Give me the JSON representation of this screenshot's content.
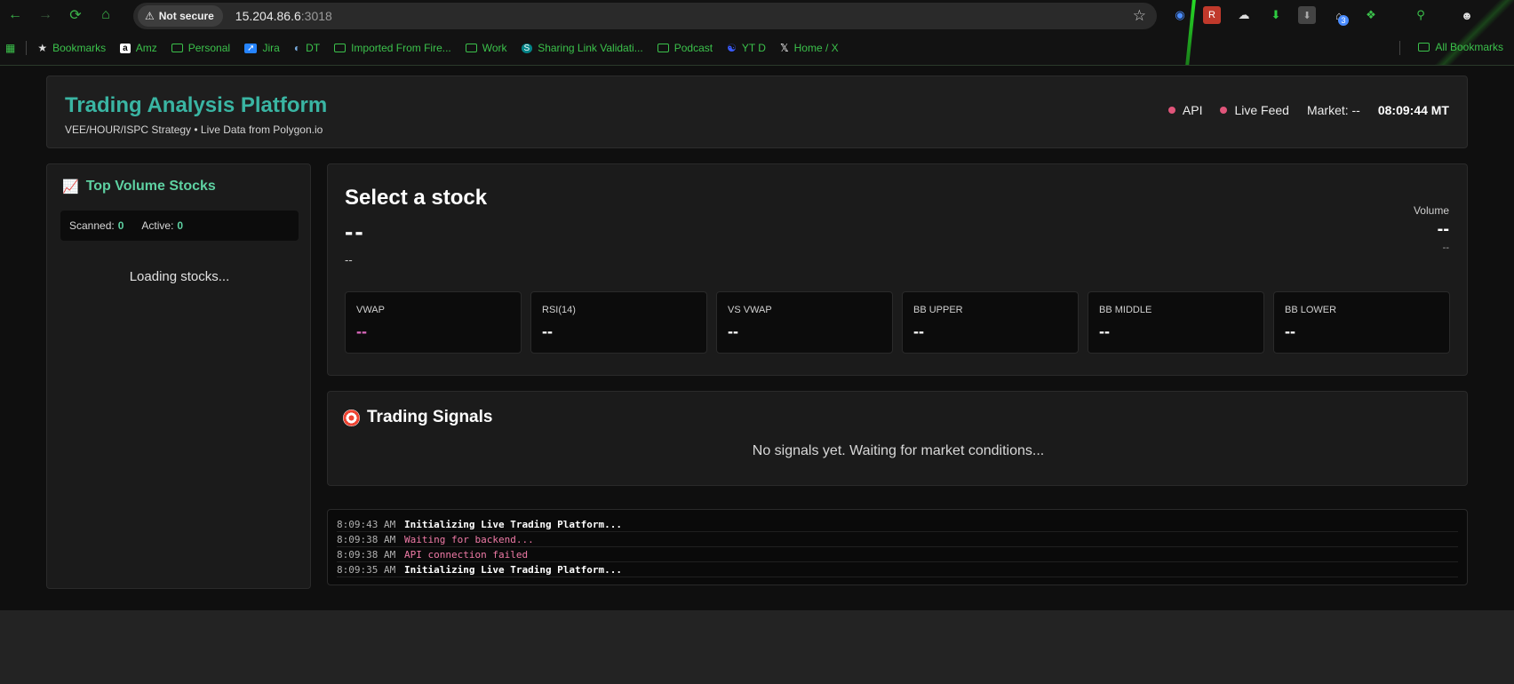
{
  "browser": {
    "security_label": "Not secure",
    "url_host": "15.204.86.6",
    "url_port": ":3018",
    "bookmarks": [
      {
        "label": "Bookmarks",
        "icon": "star-icon"
      },
      {
        "label": "Amz",
        "icon": "amazon-icon"
      },
      {
        "label": "Personal",
        "icon": "folder-icon"
      },
      {
        "label": "Jira",
        "icon": "jira-icon"
      },
      {
        "label": "DT",
        "icon": "dt-icon"
      },
      {
        "label": "Imported From Fire...",
        "icon": "folder-icon"
      },
      {
        "label": "Work",
        "icon": "folder-icon"
      },
      {
        "label": "Sharing Link Validati...",
        "icon": "sharepoint-icon"
      },
      {
        "label": "Podcast",
        "icon": "folder-icon"
      },
      {
        "label": "YT D",
        "icon": "yt-d-icon"
      },
      {
        "label": "Home / X",
        "icon": "x-icon"
      }
    ],
    "all_bookmarks_label": "All Bookmarks",
    "extension_badge": "3"
  },
  "header": {
    "title": "Trading Analysis Platform",
    "subtitle": "VEE/HOUR/ISPC Strategy • Live Data from Polygon.io",
    "api_label": "API",
    "feed_label": "Live Feed",
    "market_label": "Market: --",
    "clock": "08:09:44 MT",
    "status_color": "#e0557a"
  },
  "sidebar": {
    "title": "Top Volume Stocks",
    "scanned_label": "Scanned:",
    "scanned_value": "0",
    "active_label": "Active:",
    "active_value": "0",
    "loading_text": "Loading stocks..."
  },
  "stock": {
    "title": "Select a stock",
    "price": "--",
    "change": "--",
    "volume_label": "Volume",
    "volume_value": "--",
    "volume_sub": "--",
    "indicators": [
      {
        "label": "VWAP",
        "value": "--"
      },
      {
        "label": "RSI(14)",
        "value": "--"
      },
      {
        "label": "VS VWAP",
        "value": "--"
      },
      {
        "label": "BB UPPER",
        "value": "--"
      },
      {
        "label": "BB MIDDLE",
        "value": "--"
      },
      {
        "label": "BB LOWER",
        "value": "--"
      }
    ]
  },
  "signals": {
    "title": "Trading Signals",
    "empty_text": "No signals yet. Waiting for market conditions..."
  },
  "log": [
    {
      "time": "8:09:43 AM",
      "message": "Initializing Live Trading Platform..."
    },
    {
      "time": "8:09:38 AM",
      "message": "Waiting for backend..."
    },
    {
      "time": "8:09:38 AM",
      "message": "API connection failed"
    },
    {
      "time": "8:09:35 AM",
      "message": "Initializing Live Trading Platform..."
    }
  ],
  "colors": {
    "accent_teal": "#3ab5a3",
    "accent_green": "#5ed1a2",
    "error_pink": "#ef7aa6"
  }
}
